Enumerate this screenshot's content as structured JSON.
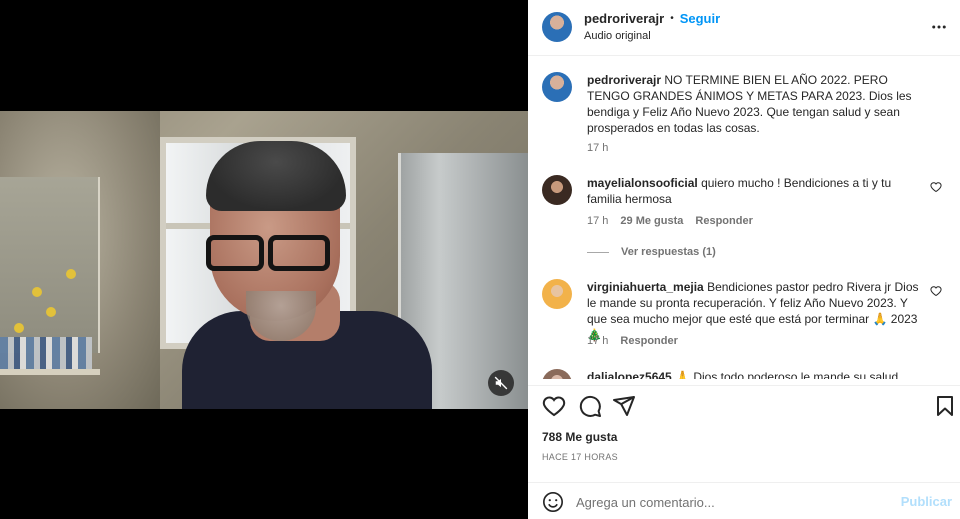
{
  "post": {
    "username": "pedroriverajr",
    "follow_label": "Seguir",
    "separator": "•",
    "audio": "Audio original"
  },
  "caption": {
    "username": "pedroriverajr",
    "text": "NO TERMINE BIEN EL AÑO 2022. PERO TENGO GRANDES ÁNIMOS Y METAS PARA 2023. Dios les bendiga y Feliz Año Nuevo 2023. Que tengan salud y sean prosperados en todas las cosas.",
    "time": "17 h"
  },
  "comments": [
    {
      "username": "mayelialonsooficial",
      "text": "quiero mucho ! Bendiciones a ti y tu familia hermosa",
      "time": "17 h",
      "likes": "29 Me gusta",
      "reply_label": "Responder",
      "view_replies": "Ver respuestas (1)"
    },
    {
      "username": "virginiahuerta_mejia",
      "text": "Bendiciones pastor pedro Rivera jr Dios le mande su pronta recuperación. Y feliz Año Nuevo 2023. Y que sea mucho mejor que esté que está por terminar 🙏 2023 🎄",
      "time": "17 h",
      "reply_label": "Responder"
    },
    {
      "username": "dalialopez5645",
      "text": "🙏 Dios todo poderoso le mande su salud"
    }
  ],
  "footer": {
    "likes": "788 Me gusta",
    "time": "HACE 17 HORAS",
    "placeholder": "Agrega un comentario...",
    "publish_label": "Publicar"
  },
  "icons": {
    "more": "more-horizontal-icon",
    "mute": "speaker-muted-icon",
    "like": "heart-icon",
    "comment": "comment-icon",
    "share": "send-icon",
    "save": "bookmark-icon",
    "emoji": "emoji-icon"
  },
  "colors": {
    "accent": "#0095f6",
    "publish_disabled": "#b2dffc",
    "muted_text": "#737373"
  }
}
